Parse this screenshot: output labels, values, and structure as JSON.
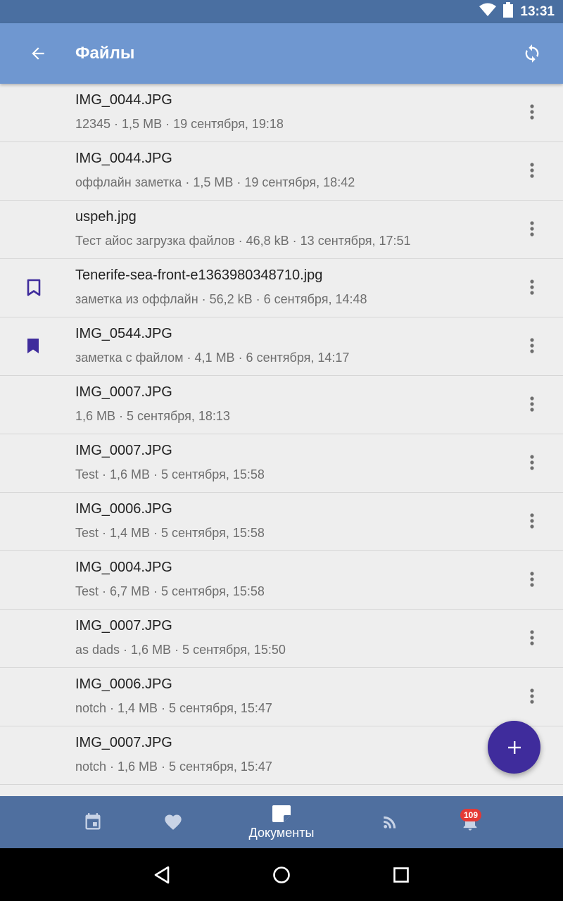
{
  "status_bar": {
    "time": "13:31"
  },
  "app_bar": {
    "title": "Файлы"
  },
  "colors": {
    "accent": "#3f2c9c",
    "app_bar": "#6f97d0",
    "bottom_nav": "#4f6f9f",
    "status_bar": "#4a6fa1",
    "badge": "#e53935"
  },
  "files": [
    {
      "name": "IMG_0044.JPG",
      "meta": "12345 · 1,5 MB · 19 сентября, 19:18",
      "bookmark": "none"
    },
    {
      "name": "IMG_0044.JPG",
      "meta": "оффлайн заметка · 1,5 MB · 19 сентября, 18:42",
      "bookmark": "none"
    },
    {
      "name": "uspeh.jpg",
      "meta": "Тест айос загрузка файлов · 46,8 kB · 13 сентября, 17:51",
      "bookmark": "none"
    },
    {
      "name": "Tenerife-sea-front-e1363980348710.jpg",
      "meta": "заметка из оффлайн · 56,2 kB · 6 сентября, 14:48",
      "bookmark": "outline"
    },
    {
      "name": "IMG_0544.JPG",
      "meta": "заметка с файлом · 4,1 MB · 6 сентября, 14:17",
      "bookmark": "filled"
    },
    {
      "name": "IMG_0007.JPG",
      "meta": "1,6 MB · 5 сентября, 18:13",
      "bookmark": "none"
    },
    {
      "name": "IMG_0007.JPG",
      "meta": "Test · 1,6 MB · 5 сентября, 15:58",
      "bookmark": "none"
    },
    {
      "name": "IMG_0006.JPG",
      "meta": "Test · 1,4 MB · 5 сентября, 15:58",
      "bookmark": "none"
    },
    {
      "name": "IMG_0004.JPG",
      "meta": "Test · 6,7 MB · 5 сентября, 15:58",
      "bookmark": "none"
    },
    {
      "name": "IMG_0007.JPG",
      "meta": "as dads · 1,6 MB · 5 сентября, 15:50",
      "bookmark": "none"
    },
    {
      "name": "IMG_0006.JPG",
      "meta": "notch · 1,4 MB · 5 сентября, 15:47",
      "bookmark": "none"
    },
    {
      "name": "IMG_0007.JPG",
      "meta": "notch · 1,6 MB · 5 сентября, 15:47",
      "bookmark": "none"
    }
  ],
  "bottom_nav": {
    "tabs": [
      {
        "icon": "calendar-icon"
      },
      {
        "icon": "heart-icon"
      },
      {
        "icon": "document-icon",
        "label": "Документы",
        "active": true
      },
      {
        "icon": "rss-icon"
      },
      {
        "icon": "bell-icon",
        "badge": "109"
      }
    ]
  }
}
